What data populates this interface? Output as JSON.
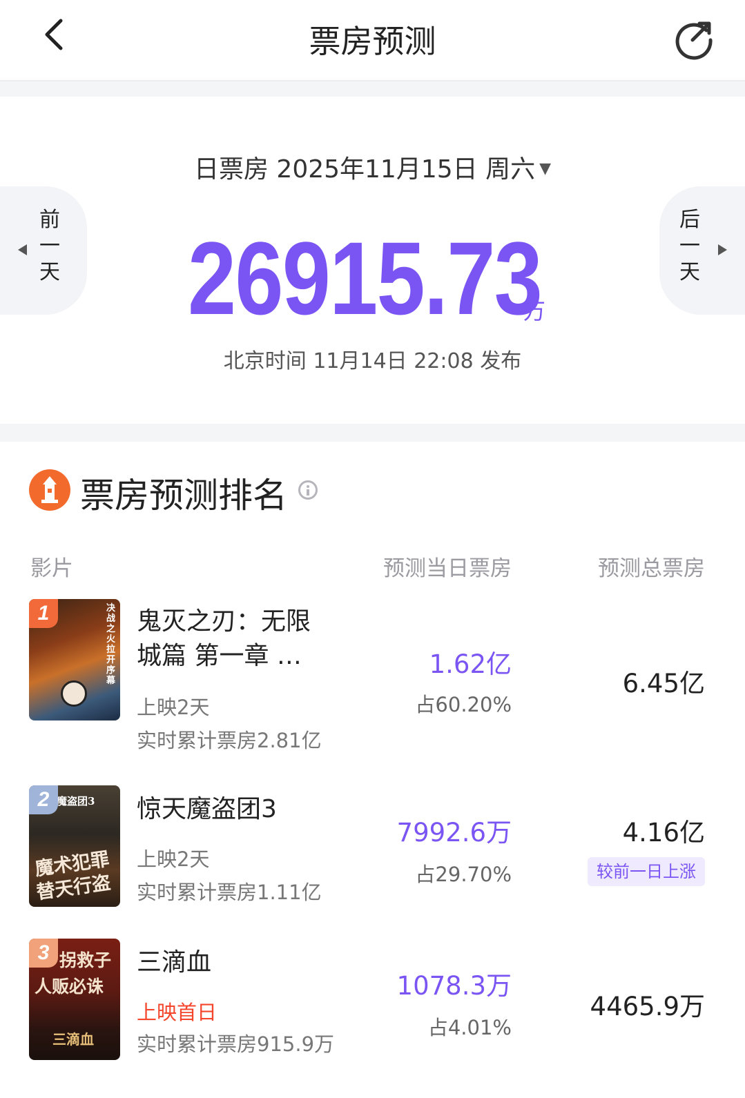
{
  "header": {
    "title": "票房预测"
  },
  "summary": {
    "date_label": "日票房 2025年11月15日 周六",
    "prev_label": [
      "前",
      "一",
      "天"
    ],
    "next_label": [
      "后",
      "一",
      "天"
    ],
    "box_office_value": "26915.73",
    "box_office_unit": "万",
    "publish_info": "北京时间 11月14日 22:08 发布"
  },
  "ranking": {
    "title": "票房预测排名",
    "columns": {
      "film": "影片",
      "day": "预测当日票房",
      "total": "预测总票房"
    },
    "movies": [
      {
        "rank": "1",
        "title": "鬼灭之刃：无限城篇 第一章 …",
        "title_line1": "鬼灭之刃：无限",
        "title_line2": "城篇 第一章 …",
        "status": "上映2天",
        "cumulative": "实时累计票房2.81亿",
        "day_box_office": "1.62亿",
        "share": "占60.20%",
        "total_box_office": "6.45亿",
        "poster_caption": "决战之火拉开序幕"
      },
      {
        "rank": "2",
        "title": "惊天魔盗团3",
        "status": "上映2天",
        "cumulative": "实时累计票房1.11亿",
        "day_box_office": "7992.6万",
        "share": "占29.70%",
        "total_box_office": "4.16亿",
        "tag": "较前一日上涨",
        "poster_caption_top": "魔盗团3",
        "poster_caption_1": "魔术犯罪",
        "poster_caption_2": "替天行盗"
      },
      {
        "rank": "3",
        "title": "三滴血",
        "status": "上映首日",
        "cumulative": "实时累计票房915.9万",
        "day_box_office": "1078.3万",
        "share": "占4.01%",
        "total_box_office": "4465.9万",
        "poster_caption_1": "拐救子",
        "poster_caption_2": "人贩必诛",
        "poster_caption_3": "三滴血"
      }
    ]
  },
  "colors": {
    "accent": "#7a55f3",
    "brand_orange": "#f36a2d",
    "first_day_red": "#f4462d"
  }
}
